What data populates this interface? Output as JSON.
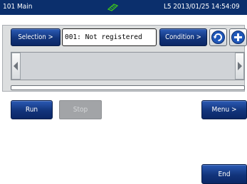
{
  "header": {
    "title": "101 Main",
    "status": "L5 2013/01/25 14:54:09",
    "status_icon": "battery-icon"
  },
  "toolbar": {
    "selection_label": "Selection >",
    "register_value": "001: Not registered",
    "condition_label": "Condition >",
    "refresh_icon": "refresh-icon",
    "add_icon": "add-icon"
  },
  "actions": {
    "run_label": "Run",
    "stop_label": "Stop",
    "menu_label": "Menu >",
    "end_label": "End"
  },
  "colors": {
    "header_bg": "#0b2f6c",
    "button_blue": "#12347b",
    "disabled_gray": "#a2a4a7",
    "panel_gray": "#dcdedf"
  }
}
